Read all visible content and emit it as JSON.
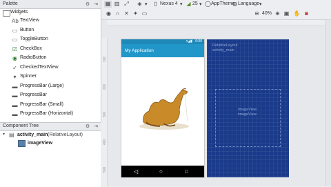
{
  "palette": {
    "title": "Palette",
    "group": "Widgets",
    "items": [
      {
        "label": "TextView",
        "icon": "textview-icon"
      },
      {
        "label": "Button",
        "icon": "button-icon"
      },
      {
        "label": "ToggleButton",
        "icon": "togglebutton-icon"
      },
      {
        "label": "CheckBox",
        "icon": "checkbox-icon"
      },
      {
        "label": "RadioButton",
        "icon": "radiobutton-icon"
      },
      {
        "label": "CheckedTextView",
        "icon": "checkedtextview-icon"
      },
      {
        "label": "Spinner",
        "icon": "spinner-icon"
      },
      {
        "label": "ProgressBar (Large)",
        "icon": "progressbar-icon"
      },
      {
        "label": "ProgressBar",
        "icon": "progressbar-icon"
      },
      {
        "label": "ProgressBar (Small)",
        "icon": "progressbar-icon"
      },
      {
        "label": "ProgressBar (Horizontal)",
        "icon": "progressbar-horizontal-icon"
      }
    ]
  },
  "component_tree": {
    "title": "Component Tree",
    "root_label": "activity_main",
    "root_type": "(RelativeLayout)",
    "child_label": "imageView"
  },
  "toolbar": {
    "device": "Nexus 4",
    "api": "25",
    "theme": "AppTheme",
    "language": "Language"
  },
  "subbar": {
    "zoom": "40%"
  },
  "phone": {
    "app_title": "My Application",
    "time": "6:00"
  },
  "blueprint": {
    "layout_label": "RelativeLayout",
    "layout_id": "activity_main",
    "image_label": "ImageView",
    "image_id": "imageView"
  },
  "rulers": {
    "v_ticks": [
      "100",
      "200",
      "300",
      "400",
      "500"
    ]
  }
}
